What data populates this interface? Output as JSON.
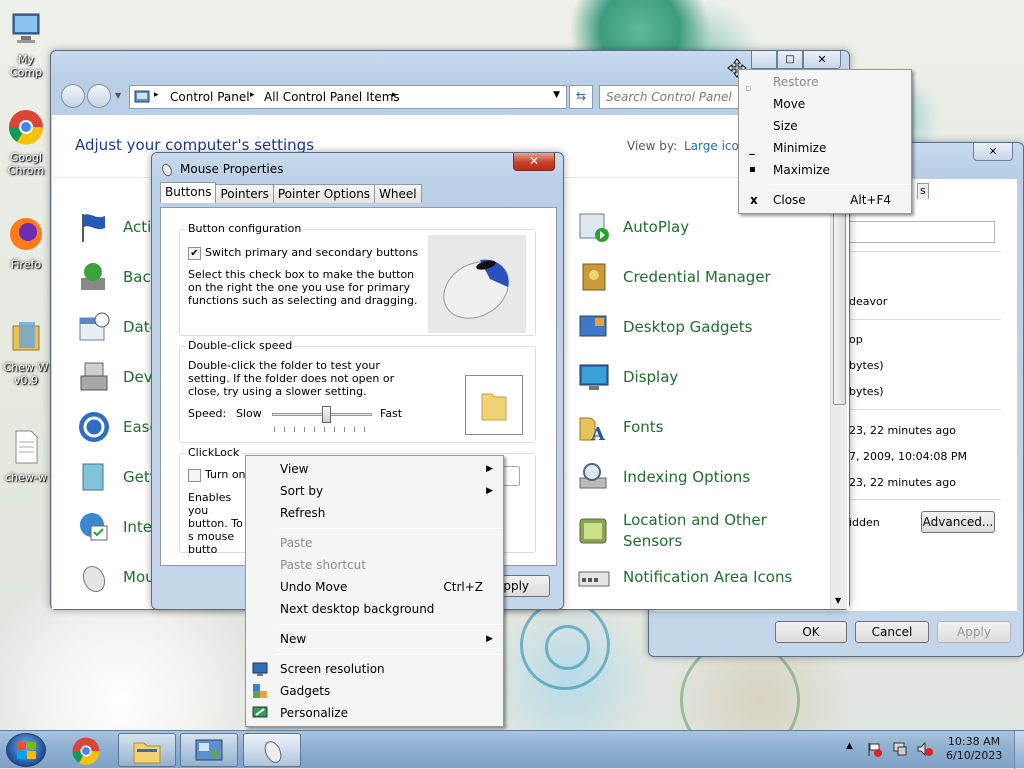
{
  "desktop": {
    "icons": [
      {
        "label": "My Comp",
        "name": "my-computer"
      },
      {
        "label": "Googl Chrom",
        "name": "google-chrome"
      },
      {
        "label": "Firefo",
        "name": "firefox"
      },
      {
        "label": "Chew W v0.9",
        "name": "chew-wga"
      },
      {
        "label": "chew-w",
        "name": "chew-wga-text"
      }
    ]
  },
  "control_panel": {
    "breadcrumb": [
      "Control Panel",
      "All Control Panel Items"
    ],
    "search_placeholder": "Search Control Panel",
    "heading": "Adjust your computer's settings",
    "view_by_label": "View by:",
    "view_by_value": "Large icons",
    "left_items": [
      "Actio",
      "Back",
      "Date",
      "Devi",
      "Ease",
      "Gett",
      "Inter",
      "Mou"
    ],
    "right_items": [
      "AutoPlay",
      "Credential Manager",
      "Desktop Gadgets",
      "Display",
      "Fonts",
      "Indexing Options",
      "Location and Other Sensors",
      "Notification Area Icons"
    ]
  },
  "back_window": {
    "lines": [
      "deavor",
      "op",
      "bytes)",
      "bytes)",
      "23, 22 minutes ago",
      "7, 2009, 10:04:08 PM",
      "23, 22 minutes ago",
      "idden"
    ],
    "advanced_button": "Advanced...",
    "tab_fragment": "s",
    "ok": "OK",
    "cancel": "Cancel",
    "apply": "Apply"
  },
  "mouse_properties": {
    "title": "Mouse Properties",
    "tabs": [
      "Buttons",
      "Pointers",
      "Pointer Options",
      "Wheel"
    ],
    "button_config": {
      "title": "Button configuration",
      "checkbox_label": "Switch primary and secondary buttons",
      "checked": true,
      "description": "Select this check box to make the button on the right the one you use for primary functions such as selecting and dragging."
    },
    "double_click": {
      "title": "Double-click speed",
      "description": "Double-click the folder to test your setting. If the folder does not open or close, try using a slower setting.",
      "speed_label": "Speed:",
      "slow": "Slow",
      "fast": "Fast",
      "speed_value": 0.55
    },
    "clicklock": {
      "title": "ClickLock",
      "checkbox_label": "Turn on C",
      "checked": false,
      "description": "Enables you button. To s mouse butto"
    },
    "apply_fragment": "pply"
  },
  "system_menu": {
    "items": [
      {
        "label": "Restore",
        "disabled": true,
        "icon": "restore-icon"
      },
      {
        "label": "Move",
        "disabled": false
      },
      {
        "label": "Size",
        "disabled": false
      },
      {
        "label": "Minimize",
        "disabled": false,
        "icon": "minimize-icon"
      },
      {
        "label": "Maximize",
        "disabled": false,
        "icon": "maximize-icon"
      },
      {
        "label": "Close",
        "disabled": false,
        "icon": "close-icon",
        "accel": "Alt+F4"
      }
    ]
  },
  "context_menu": {
    "view": "View",
    "sort_by": "Sort by",
    "refresh": "Refresh",
    "paste": "Paste",
    "paste_shortcut": "Paste shortcut",
    "undo_move": "Undo Move",
    "undo_accel": "Ctrl+Z",
    "next_background": "Next desktop background",
    "new": "New",
    "screen_resolution": "Screen resolution",
    "gadgets": "Gadgets",
    "personalize": "Personalize"
  },
  "taskbar": {
    "time": "10:38 AM",
    "date": "6/10/2023"
  }
}
